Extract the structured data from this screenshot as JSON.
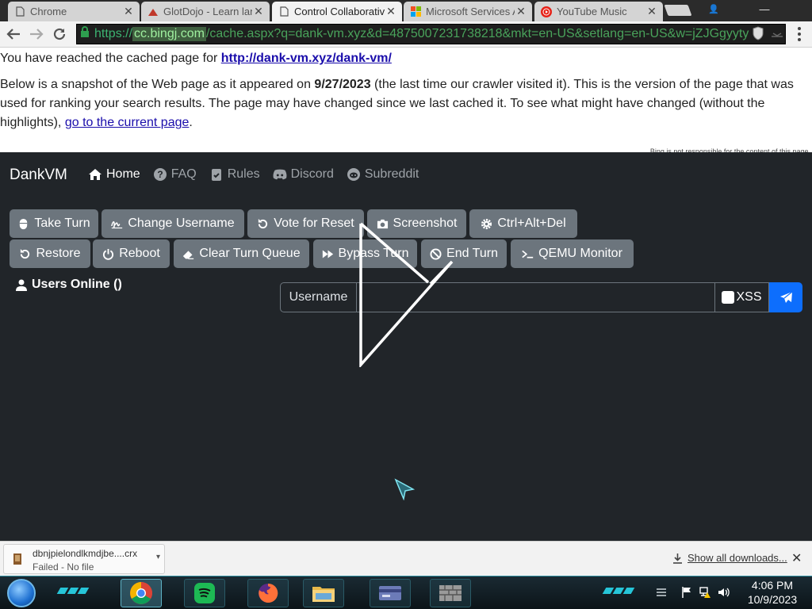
{
  "browser": {
    "tabs": [
      {
        "title": "Chrome",
        "icon": "page-icon",
        "active": false
      },
      {
        "title": "GlotDojo - Learn lan",
        "icon": "glotdojo-icon",
        "active": false
      },
      {
        "title": "Control Collaborativ",
        "icon": "page-icon",
        "active": true
      },
      {
        "title": "Microsoft Services A",
        "icon": "microsoft-icon",
        "active": false
      },
      {
        "title": "YouTube Music",
        "icon": "youtube-music-icon",
        "active": false
      }
    ],
    "tab_close_glyph": "✕",
    "window_user_glyph": "👤",
    "window_minimize_glyph": "—",
    "url": {
      "scheme": "https://",
      "host": "cc.bingj.com",
      "path": "/cache.aspx?q=dank-vm.xyz&d=4875007231738218&mkt=en-US&setlang=en-US&w=jZJGgyyty"
    }
  },
  "cache_header": {
    "line1_prefix": "You have reached the cached page for ",
    "cached_url": "http://dank-vm.xyz/dank-vm/",
    "body_part1": "Below is a snapshot of the Web page as it appeared on ",
    "snapshot_date": "9/27/2023",
    "body_part2": " (the last time our crawler visited it). This is the version of the page that was used for ranking your search results. The page may have changed since we last cached it. To see what might have changed (without the highlights), ",
    "current_page_link": "go to the current page",
    "body_part3": ".",
    "disclaimer": "Bing is not responsible for the content of this page."
  },
  "dankvm": {
    "brand": "DankVM",
    "nav": [
      {
        "label": "Home",
        "icon": "home-icon",
        "active": true
      },
      {
        "label": "FAQ",
        "icon": "question-circle-icon",
        "active": false
      },
      {
        "label": "Rules",
        "icon": "clipboard-check-icon",
        "active": false
      },
      {
        "label": "Discord",
        "icon": "discord-icon",
        "active": false
      },
      {
        "label": "Subreddit",
        "icon": "reddit-icon",
        "active": false
      }
    ],
    "buttons_row1": [
      {
        "label": "Take Turn",
        "icon": "mouse-icon"
      },
      {
        "label": "Change Username",
        "icon": "signature-icon"
      },
      {
        "label": "Vote for Reset",
        "icon": "rotate-left-icon"
      },
      {
        "label": "Screenshot",
        "icon": "camera-icon"
      },
      {
        "label": "Ctrl+Alt+Del",
        "icon": "gear-icon"
      }
    ],
    "buttons_row2": [
      {
        "label": "Restore",
        "icon": "rotate-left-icon"
      },
      {
        "label": "Reboot",
        "icon": "power-icon"
      },
      {
        "label": "Clear Turn Queue",
        "icon": "eraser-icon"
      },
      {
        "label": "Bypass Turn",
        "icon": "forward-icon"
      },
      {
        "label": "End Turn",
        "icon": "ban-icon"
      },
      {
        "label": "QEMU Monitor",
        "icon": "terminal-icon"
      }
    ],
    "users_online": "Users Online ()",
    "chat": {
      "username_label": "Username",
      "message_value": "",
      "xss_label": "XSS",
      "xss_checked": false,
      "send_icon": "paper-plane-icon"
    },
    "colors": {
      "background": "#212529",
      "button": "#6c757d",
      "send": "#0d6efd"
    }
  },
  "download_bar": {
    "file_name": "dbnjpielondlkmdjbe....crx",
    "status": "Failed - No file",
    "show_all": "Show all downloads...",
    "close_glyph": "✕"
  },
  "taskbar": {
    "apps": [
      "chrome-icon",
      "spotify-icon",
      "firefox-icon",
      "file-explorer-icon",
      "card-app-icon",
      "wall-app-icon"
    ],
    "time": "4:06 PM",
    "date": "10/9/2023"
  }
}
